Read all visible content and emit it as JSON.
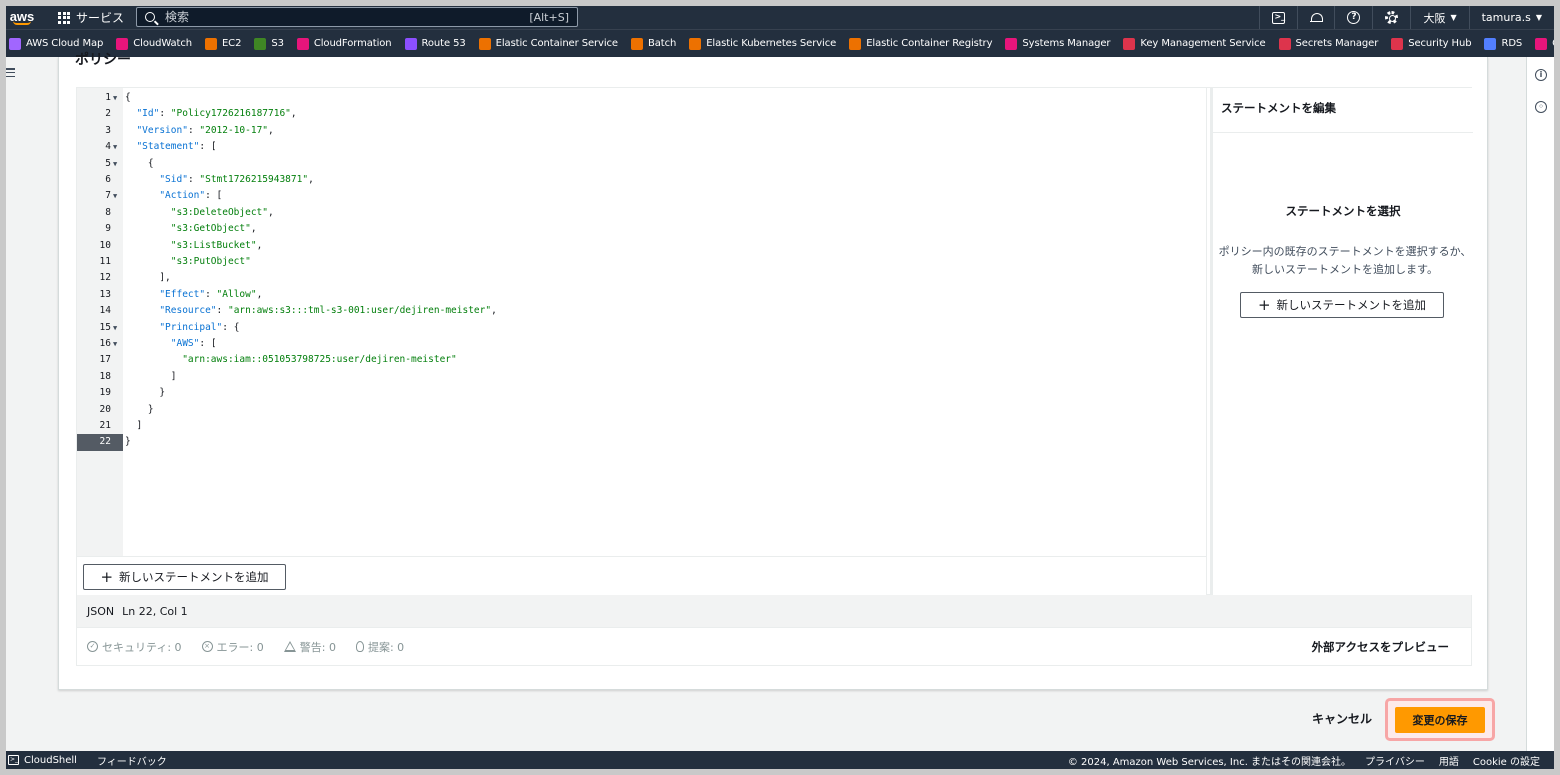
{
  "topnav": {
    "logo": "aws",
    "services_label": "サービス",
    "search_placeholder": "検索",
    "search_shortcut": "[Alt+S]",
    "region": "大阪",
    "user": "tamura.s"
  },
  "favorites": [
    {
      "label": "AWS Cloud Map",
      "color": "#a166ff"
    },
    {
      "label": "CloudWatch",
      "color": "#e7157b"
    },
    {
      "label": "EC2",
      "color": "#ed7100"
    },
    {
      "label": "S3",
      "color": "#3f8624"
    },
    {
      "label": "CloudFormation",
      "color": "#e7157b"
    },
    {
      "label": "Route 53",
      "color": "#8c4fff"
    },
    {
      "label": "Elastic Container Service",
      "color": "#ed7100"
    },
    {
      "label": "Batch",
      "color": "#ed7100"
    },
    {
      "label": "Elastic Kubernetes Service",
      "color": "#ed7100"
    },
    {
      "label": "Elastic Container Registry",
      "color": "#ed7100"
    },
    {
      "label": "Systems Manager",
      "color": "#e7157b"
    },
    {
      "label": "Key Management Service",
      "color": "#dd344c"
    },
    {
      "label": "Secrets Manager",
      "color": "#dd344c"
    },
    {
      "label": "Security Hub",
      "color": "#dd344c"
    },
    {
      "label": "RDS",
      "color": "#527fff"
    },
    {
      "label": "CloudTrail",
      "color": "#e7157b"
    }
  ],
  "panel": {
    "heading": "ポリシー"
  },
  "code_lines": [
    [
      {
        "t": "{",
        "c": ""
      }
    ],
    [
      {
        "t": "  ",
        "c": ""
      },
      {
        "t": "\"Id\"",
        "c": "k"
      },
      {
        "t": ": ",
        "c": ""
      },
      {
        "t": "\"Policy1726216187716\"",
        "c": "s"
      },
      {
        "t": ",",
        "c": ""
      }
    ],
    [
      {
        "t": "  ",
        "c": ""
      },
      {
        "t": "\"Version\"",
        "c": "k"
      },
      {
        "t": ": ",
        "c": ""
      },
      {
        "t": "\"2012-10-17\"",
        "c": "s"
      },
      {
        "t": ",",
        "c": ""
      }
    ],
    [
      {
        "t": "  ",
        "c": ""
      },
      {
        "t": "\"Statement\"",
        "c": "k"
      },
      {
        "t": ": [",
        "c": ""
      }
    ],
    [
      {
        "t": "    {",
        "c": ""
      }
    ],
    [
      {
        "t": "      ",
        "c": ""
      },
      {
        "t": "\"Sid\"",
        "c": "k"
      },
      {
        "t": ": ",
        "c": ""
      },
      {
        "t": "\"Stmt1726215943871\"",
        "c": "s"
      },
      {
        "t": ",",
        "c": ""
      }
    ],
    [
      {
        "t": "      ",
        "c": ""
      },
      {
        "t": "\"Action\"",
        "c": "k"
      },
      {
        "t": ": [",
        "c": ""
      }
    ],
    [
      {
        "t": "        ",
        "c": ""
      },
      {
        "t": "\"s3:DeleteObject\"",
        "c": "s"
      },
      {
        "t": ",",
        "c": ""
      }
    ],
    [
      {
        "t": "        ",
        "c": ""
      },
      {
        "t": "\"s3:GetObject\"",
        "c": "s"
      },
      {
        "t": ",",
        "c": ""
      }
    ],
    [
      {
        "t": "        ",
        "c": ""
      },
      {
        "t": "\"s3:ListBucket\"",
        "c": "s"
      },
      {
        "t": ",",
        "c": ""
      }
    ],
    [
      {
        "t": "        ",
        "c": ""
      },
      {
        "t": "\"s3:PutObject\"",
        "c": "s"
      }
    ],
    [
      {
        "t": "      ],",
        "c": ""
      }
    ],
    [
      {
        "t": "      ",
        "c": ""
      },
      {
        "t": "\"Effect\"",
        "c": "k"
      },
      {
        "t": ": ",
        "c": ""
      },
      {
        "t": "\"Allow\"",
        "c": "s"
      },
      {
        "t": ",",
        "c": ""
      }
    ],
    [
      {
        "t": "      ",
        "c": ""
      },
      {
        "t": "\"Resource\"",
        "c": "k"
      },
      {
        "t": ": ",
        "c": ""
      },
      {
        "t": "\"arn:aws:s3:::tml-s3-001:user/dejiren-meister\"",
        "c": "s"
      },
      {
        "t": ",",
        "c": ""
      }
    ],
    [
      {
        "t": "      ",
        "c": ""
      },
      {
        "t": "\"Principal\"",
        "c": "k"
      },
      {
        "t": ": {",
        "c": ""
      }
    ],
    [
      {
        "t": "        ",
        "c": ""
      },
      {
        "t": "\"AWS\"",
        "c": "k"
      },
      {
        "t": ": [",
        "c": ""
      }
    ],
    [
      {
        "t": "          ",
        "c": ""
      },
      {
        "t": "\"arn:aws:iam::051053798725:user/dejiren-meister\"",
        "c": "s"
      }
    ],
    [
      {
        "t": "        ]",
        "c": ""
      }
    ],
    [
      {
        "t": "      }",
        "c": ""
      }
    ],
    [
      {
        "t": "    }",
        "c": ""
      }
    ],
    [
      {
        "t": "  ]",
        "c": ""
      }
    ],
    [
      {
        "t": "}",
        "c": ""
      }
    ]
  ],
  "foldable_lines": [
    1,
    4,
    5,
    7,
    15,
    16
  ],
  "active_line": 22,
  "editor": {
    "add_statement_label": "新しいステートメントを追加",
    "language": "JSON",
    "cursor": "Ln 22, Col 1"
  },
  "side": {
    "header": "ステートメントを編集",
    "title": "ステートメントを選択",
    "description": "ポリシー内の既存のステートメントを選択するか、新しいステートメントを追加します。",
    "add_label": "新しいステートメントを追加"
  },
  "validation": {
    "security": "セキュリティ: 0",
    "errors": "エラー: 0",
    "warnings": "警告: 0",
    "suggestions": "提案: 0",
    "preview_label": "外部アクセスをプレビュー"
  },
  "actions": {
    "cancel": "キャンセル",
    "save": "変更の保存"
  },
  "footer": {
    "cloudshell": "CloudShell",
    "feedback": "フィードバック",
    "copyright": "© 2024, Amazon Web Services, Inc. またはその関連会社。",
    "privacy": "プライバシー",
    "terms": "用語",
    "cookies": "Cookie の設定"
  }
}
